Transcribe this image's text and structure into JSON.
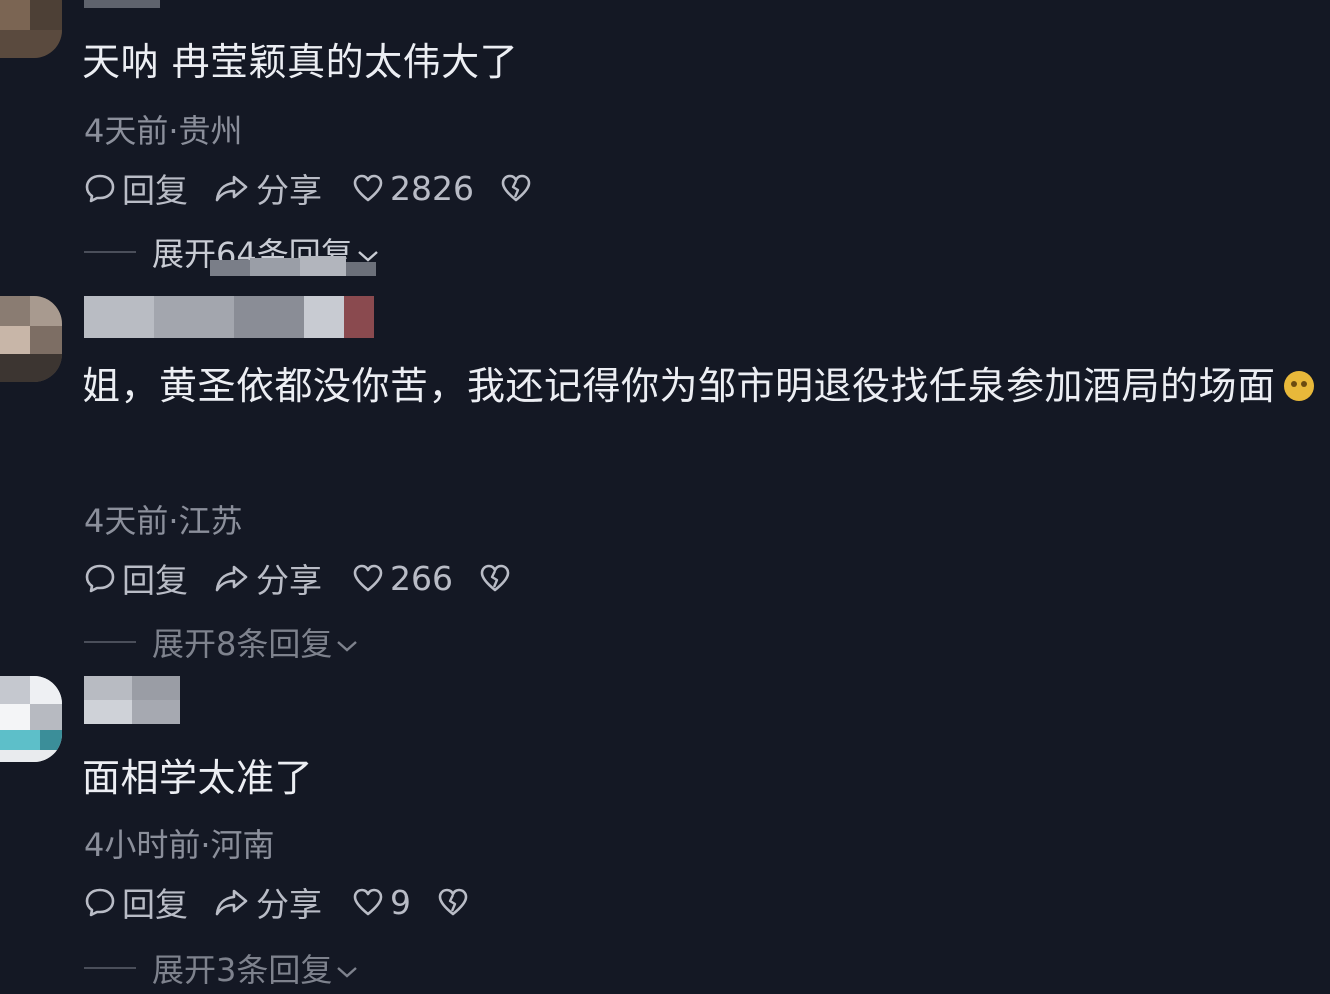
{
  "comments": [
    {
      "text": "天呐 冉莹颖真的太伟大了",
      "meta": "4天前·贵州",
      "reply_label": "回复",
      "share_label": "分享",
      "likes": "2826",
      "expand_label": "展开64条回复"
    },
    {
      "text": "姐，黄圣依都没你苦，我还记得你为邹市明退役找任泉参加酒局的场面",
      "meta": "4天前·江苏",
      "reply_label": "回复",
      "share_label": "分享",
      "likes": "266",
      "expand_label": "展开8条回复"
    },
    {
      "text": "面相学太准了",
      "meta": "4小时前·河南",
      "reply_label": "回复",
      "share_label": "分享",
      "likes": "9",
      "expand_label": "展开3条回复"
    }
  ],
  "icons": {
    "reply": "comment-bubble-icon",
    "share": "share-arrow-icon",
    "like": "heart-icon",
    "dislike": "broken-heart-icon",
    "expand": "chevron-down-icon"
  },
  "colors": {
    "background": "#141824",
    "text": "#eceef3",
    "meta": "#8b8f9b",
    "actions": "#b9bcc6"
  }
}
